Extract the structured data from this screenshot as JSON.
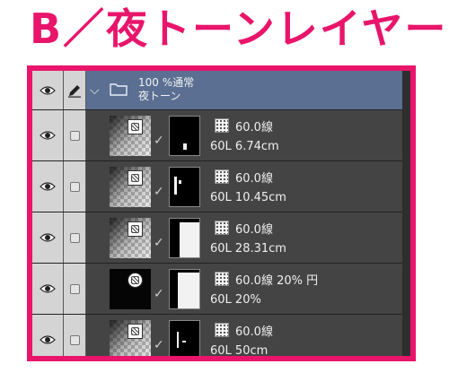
{
  "heading": "B／夜トーンレイヤー",
  "folder": {
    "opacity_blend": "100 %通常",
    "name": "夜トーン"
  },
  "layers": [
    {
      "tone": "60.0線",
      "name": "60L 6.74cm",
      "thumb_dark": false,
      "mask_white": false
    },
    {
      "tone": "60.0線",
      "name": "60L 10.45cm",
      "thumb_dark": false,
      "mask_white": false
    },
    {
      "tone": "60.0線",
      "name": "60L 28.31cm",
      "thumb_dark": false,
      "mask_white": true
    },
    {
      "tone": "60.0線 20% 円",
      "name": "60L 20%",
      "thumb_dark": true,
      "mask_white": true
    },
    {
      "tone": "60.0線",
      "name": "60L 50cm",
      "thumb_dark": false,
      "mask_white": false
    }
  ],
  "colors": {
    "accent": "#e8156b",
    "folder_row": "#5a6f92",
    "panel": "#3b3b3b"
  }
}
